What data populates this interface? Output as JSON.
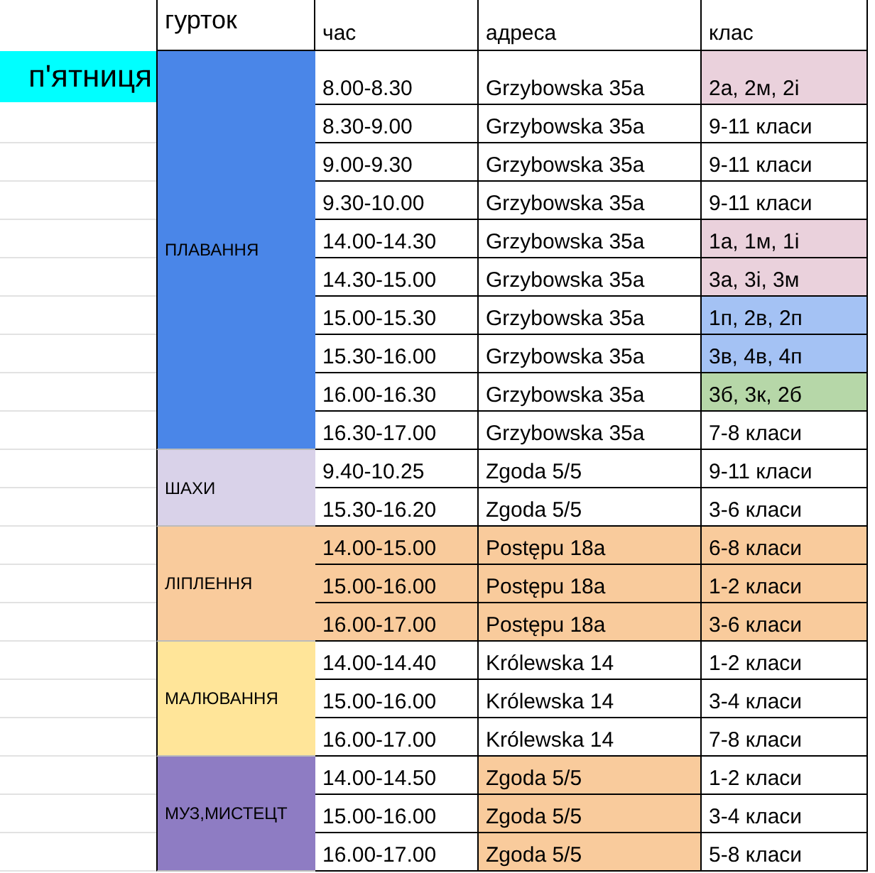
{
  "header": {
    "group": "гурток",
    "time": "час",
    "address": "адреса",
    "grade": "клас"
  },
  "day": {
    "label": "п'ятниця",
    "color": "#00ffff"
  },
  "groups": [
    {
      "name": "ПЛАВАННЯ",
      "color": "#4a86e8",
      "rows": [
        {
          "cells": [
            {
              "text": "8.00-8.30"
            },
            {
              "text": "Grzybowska 35a"
            },
            {
              "text": "2а, 2м, 2і",
              "color": "#ead1dc"
            }
          ]
        },
        {
          "cells": [
            {
              "text": "8.30-9.00"
            },
            {
              "text": "Grzybowska 35a"
            },
            {
              "text": "9-11 класи"
            }
          ]
        },
        {
          "cells": [
            {
              "text": "9.00-9.30"
            },
            {
              "text": "Grzybowska 35a"
            },
            {
              "text": "9-11 класи"
            }
          ]
        },
        {
          "cells": [
            {
              "text": "9.30-10.00"
            },
            {
              "text": "Grzybowska 35a"
            },
            {
              "text": "9-11 класи"
            }
          ]
        },
        {
          "cells": [
            {
              "text": "14.00-14.30"
            },
            {
              "text": "Grzybowska 35a"
            },
            {
              "text": "1а, 1м, 1і",
              "color": "#ead1dc"
            }
          ]
        },
        {
          "cells": [
            {
              "text": "14.30-15.00"
            },
            {
              "text": "Grzybowska 35a"
            },
            {
              "text": "3а, 3і, 3м",
              "color": "#ead1dc"
            }
          ]
        },
        {
          "cells": [
            {
              "text": "15.00-15.30"
            },
            {
              "text": "Grzybowska 35a"
            },
            {
              "text": "1п, 2в, 2п",
              "color": "#a4c2f4"
            }
          ]
        },
        {
          "cells": [
            {
              "text": "15.30-16.00"
            },
            {
              "text": "Grzybowska 35a"
            },
            {
              "text": "3в, 4в, 4п",
              "color": "#a4c2f4"
            }
          ]
        },
        {
          "cells": [
            {
              "text": "16.00-16.30"
            },
            {
              "text": "Grzybowska 35a"
            },
            {
              "text": "3б, 3к, 2б",
              "color": "#b6d7a8"
            }
          ]
        },
        {
          "cells": [
            {
              "text": "16.30-17.00"
            },
            {
              "text": "Grzybowska 35a"
            },
            {
              "text": "7-8 класи"
            }
          ]
        }
      ]
    },
    {
      "name": "ШАХИ",
      "color": "#d9d2e9",
      "rows": [
        {
          "cells": [
            {
              "text": "9.40-10.25"
            },
            {
              "text": "Zgoda 5/5"
            },
            {
              "text": "9-11 класи"
            }
          ]
        },
        {
          "cells": [
            {
              "text": "15.30-16.20"
            },
            {
              "text": "Zgoda 5/5"
            },
            {
              "text": "3-6 класи"
            }
          ]
        }
      ]
    },
    {
      "name": "ЛІПЛЕННЯ",
      "color": "#f9cb9c",
      "rows": [
        {
          "cells": [
            {
              "text": "14.00-15.00",
              "color": "#f9cb9c"
            },
            {
              "text": "Postępu 18a",
              "color": "#f9cb9c"
            },
            {
              "text": "6-8 класи",
              "color": "#f9cb9c"
            }
          ]
        },
        {
          "cells": [
            {
              "text": "15.00-16.00",
              "color": "#f9cb9c"
            },
            {
              "text": "Postępu 18a",
              "color": "#f9cb9c"
            },
            {
              "text": "1-2 класи",
              "color": "#f9cb9c"
            }
          ]
        },
        {
          "cells": [
            {
              "text": "16.00-17.00",
              "color": "#f9cb9c"
            },
            {
              "text": "Postępu 18a",
              "color": "#f9cb9c"
            },
            {
              "text": "3-6 класи",
              "color": "#f9cb9c"
            }
          ]
        }
      ]
    },
    {
      "name": "МАЛЮВАННЯ",
      "color": "#ffe599",
      "rows": [
        {
          "cells": [
            {
              "text": "14.00-14.40"
            },
            {
              "text": "Królewska 14"
            },
            {
              "text": "1-2 класи"
            }
          ]
        },
        {
          "cells": [
            {
              "text": "15.00-16.00"
            },
            {
              "text": "Królewska 14"
            },
            {
              "text": "3-4 класи"
            }
          ]
        },
        {
          "cells": [
            {
              "text": "16.00-17.00"
            },
            {
              "text": "Królewska 14"
            },
            {
              "text": "7-8 класи"
            }
          ]
        }
      ]
    },
    {
      "name": "МУЗ,МИСТЕЦТ",
      "color": "#8e7cc3",
      "rows": [
        {
          "cells": [
            {
              "text": "14.00-14.50"
            },
            {
              "text": "Zgoda 5/5",
              "color": "#f9cb9c"
            },
            {
              "text": "1-2 класи"
            }
          ]
        },
        {
          "cells": [
            {
              "text": "15.00-16.00"
            },
            {
              "text": "Zgoda 5/5",
              "color": "#f9cb9c"
            },
            {
              "text": "3-4 класи"
            }
          ]
        },
        {
          "cells": [
            {
              "text": "16.00-17.00"
            },
            {
              "text": "Zgoda 5/5",
              "color": "#f9cb9c"
            },
            {
              "text": "5-8 класи"
            }
          ]
        }
      ]
    }
  ]
}
